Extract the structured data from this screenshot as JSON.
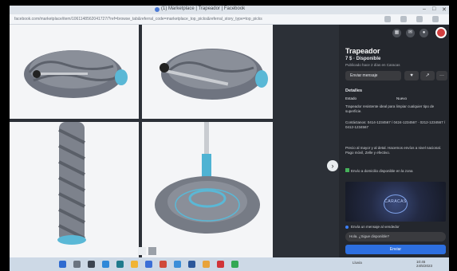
{
  "browser": {
    "tab_title": "(1) Marketplace | Trapeador | Facebook",
    "url": "facebook.com/marketplace/item/1061148562041727/?ref=browse_tab&referral_code=marketplace_top_picks&referral_story_type=top_picks",
    "window_controls": {
      "minimize": "–",
      "maximize": "□",
      "close": "✕"
    }
  },
  "viewer": {
    "next_icon": "›",
    "nav_icon": "photo-thumbnails-icon"
  },
  "listing": {
    "title": "Trapeador",
    "price": "7 $ · Disponible",
    "listed": "Publicado hace 2 días en Caracas",
    "message_button": "Enviar mensaje",
    "save_icon": "♥",
    "share_icon": "↗",
    "more_icon": "···",
    "details_heading": "Detalles",
    "condition_label": "Estado",
    "condition_value": "Nuevo",
    "description_1": "Trapeador resistente ideal para limpiar cualquier tipo de superficie.",
    "description_2": "Contáctanos: 0414-1234567 / 0424-1234567 · 0212-1234567 / 0412-1234567",
    "description_3": "Precio al mayor y al detal. Hacemos envíos a nivel nacional. Pago móvil, Zelle y efectivo.",
    "shipping": "Envío a domicilio disponible en la zona",
    "map_label": "CARACAS",
    "seller_note": "Envía un mensaje al vendedor",
    "message_placeholder": "Hola. ¿Sigue disponible?",
    "send_button": "Enviar"
  },
  "taskbar": {
    "tray": "Lluvia",
    "time": "10:45",
    "date": "24/5/2023"
  }
}
